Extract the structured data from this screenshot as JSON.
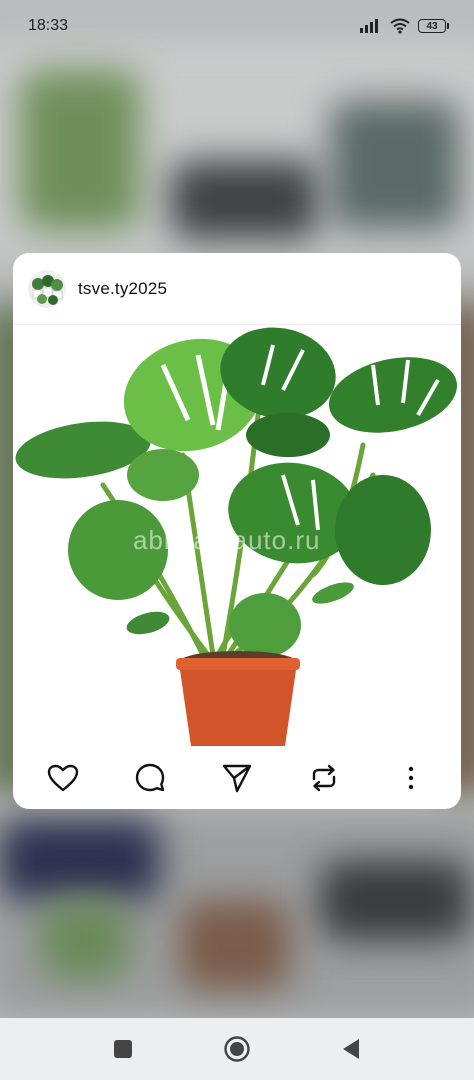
{
  "status_bar": {
    "time": "18:33",
    "battery": "43",
    "icons": [
      "signal-icon",
      "wifi-icon",
      "battery-icon"
    ]
  },
  "post": {
    "username": "tsve.ty2025",
    "avatar_icon": "avatar",
    "watermark": "abkhaz-auto.ru",
    "actions": [
      "heart-icon",
      "comment-icon",
      "share-icon",
      "repost-icon",
      "more-icon"
    ]
  },
  "nav_bar": {
    "icons": [
      "recents-icon",
      "home-icon",
      "back-icon"
    ]
  },
  "colors": {
    "card_background": "#ffffff",
    "pot": "#d2542b",
    "leaf": "#3a8a2e",
    "nav_background": "#eceef0"
  }
}
